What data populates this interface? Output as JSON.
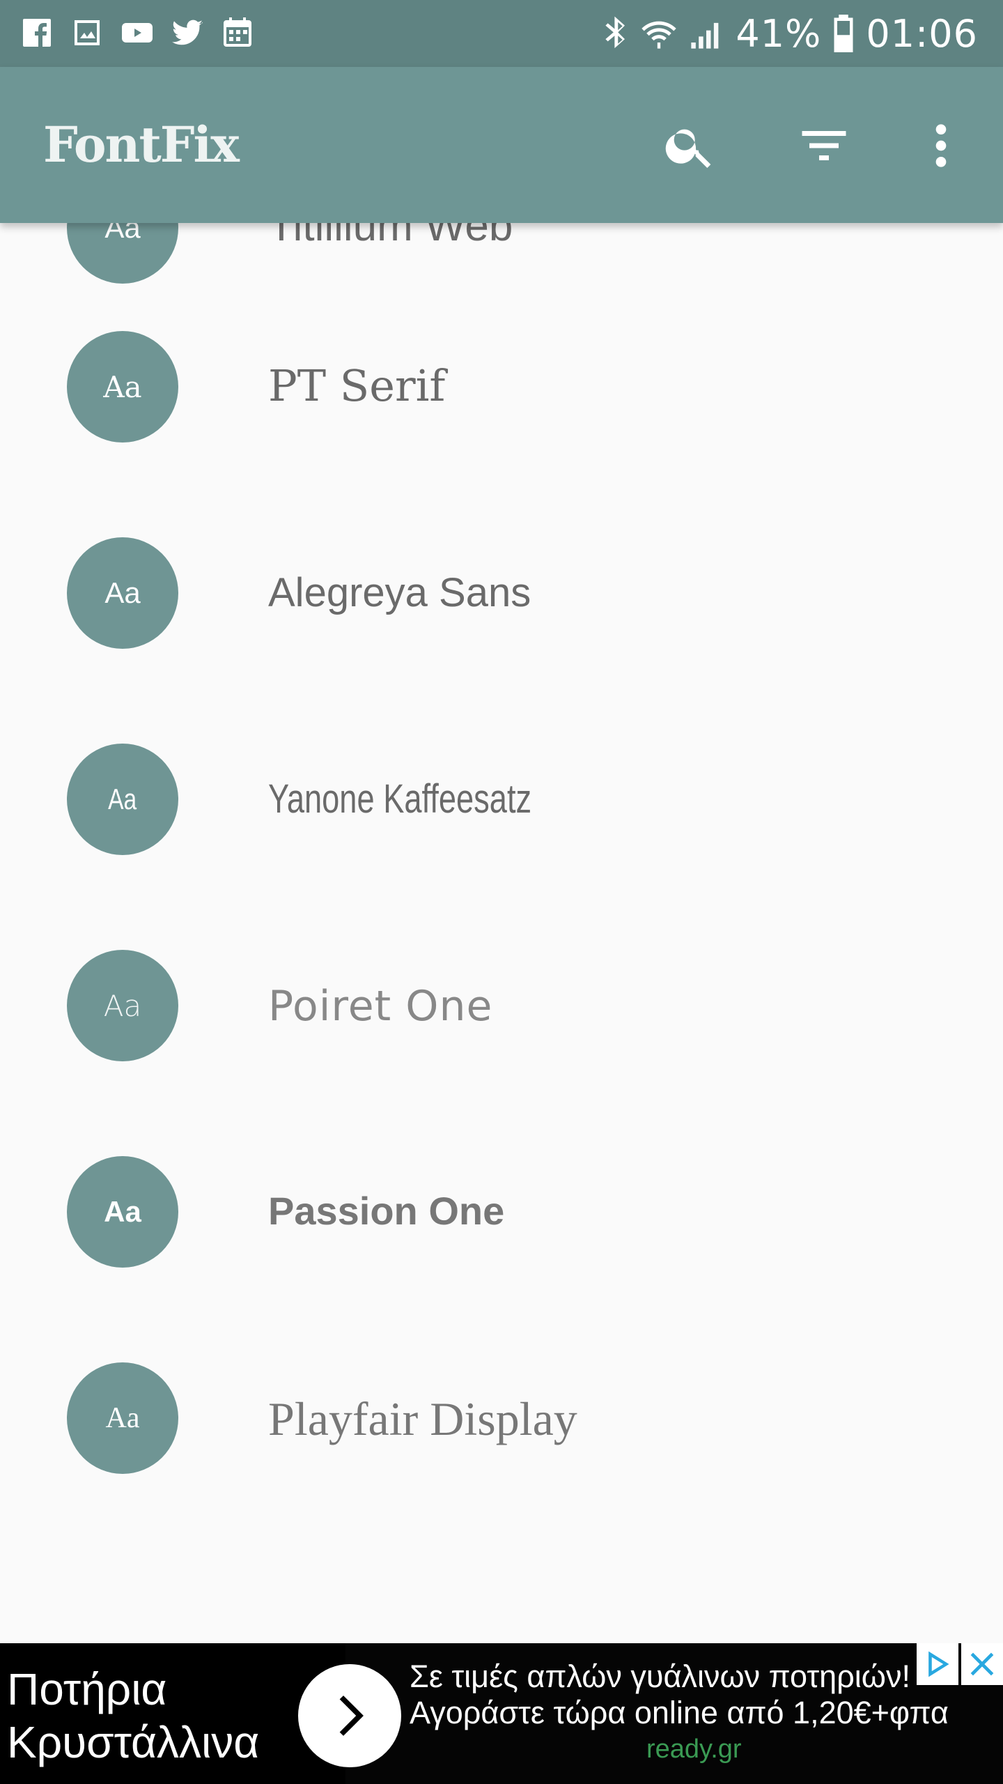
{
  "status_bar": {
    "notifications": [
      "facebook-icon",
      "gallery-icon",
      "youtube-icon",
      "twitter-icon",
      "calendar-icon"
    ],
    "battery": "41%",
    "time": "01:06"
  },
  "app_bar": {
    "title": "FontFix",
    "actions": [
      "search-icon",
      "filter-icon",
      "more-vert-icon"
    ]
  },
  "fonts": [
    {
      "name": "Titillium Web",
      "preview": "Aa"
    },
    {
      "name": "PT Serif",
      "preview": "Aa"
    },
    {
      "name": "Alegreya Sans",
      "preview": "Aa"
    },
    {
      "name": "Yanone Kaffeesatz",
      "preview": "Aa"
    },
    {
      "name": "Poiret One",
      "preview": "Aa"
    },
    {
      "name": "Passion One",
      "preview": "Aa"
    },
    {
      "name": "Playfair Display",
      "preview": "Aa"
    }
  ],
  "ad": {
    "headline_line1": "Ποτήρια",
    "headline_line2": "Κρυστάλλινα",
    "text_line1": "Σε τιμές απλών γυάλινων ποτηριών!",
    "text_line2": "Αγοράστε τώρα online από 1,20€+φπα",
    "domain": "ready.gr"
  },
  "colors": {
    "status_bar": "#5f8382",
    "app_bar": "#6e9695",
    "avatar": "#6f9594",
    "background": "#fafafa"
  }
}
